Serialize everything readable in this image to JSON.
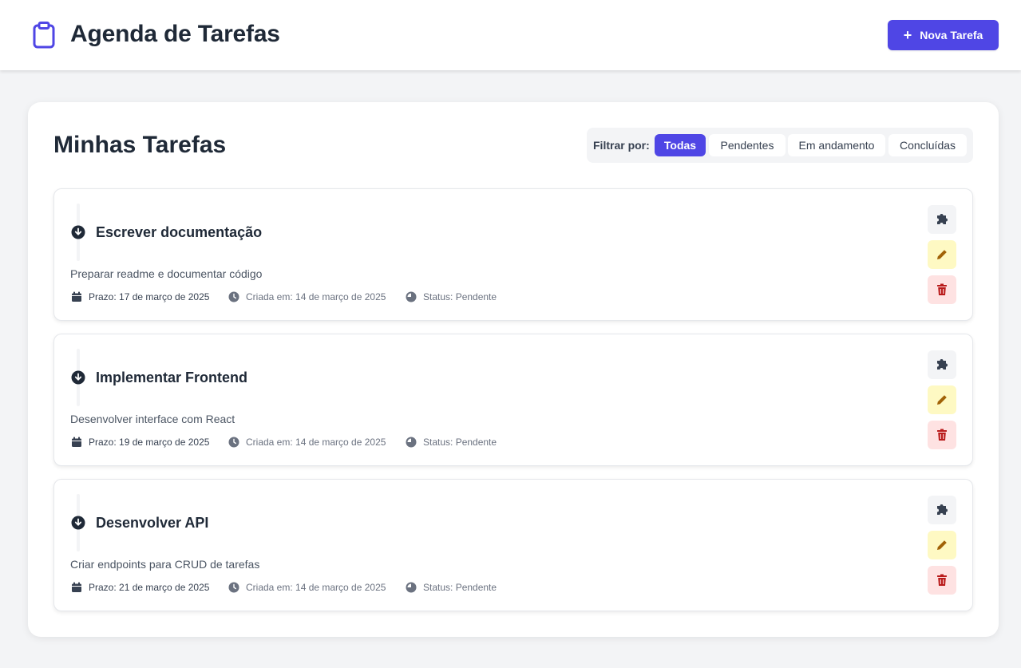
{
  "header": {
    "title": "Agenda de Tarefas",
    "icon": "clipboard-icon",
    "new_task_label": "Nova Tarefa"
  },
  "main": {
    "title": "Minhas Tarefas",
    "filter": {
      "label": "Filtrar por:",
      "options": [
        "Todas",
        "Pendentes",
        "Em andamento",
        "Concluídas"
      ],
      "selected": "Todas"
    },
    "tasks": [
      {
        "title": "Escrever documentação",
        "description": "Preparar readme e documentar código",
        "due": "Prazo: 17 de março de 2025",
        "created": "Criada em: 14 de março de 2025",
        "status": "Status: Pendente"
      },
      {
        "title": "Implementar Frontend",
        "description": "Desenvolver interface com React",
        "due": "Prazo: 19 de março de 2025",
        "created": "Criada em: 14 de março de 2025",
        "status": "Status: Pendente"
      },
      {
        "title": "Desenvolver API",
        "description": "Criar endpoints para CRUD de tarefas",
        "due": "Prazo: 21 de março de 2025",
        "created": "Criada em: 14 de março de 2025",
        "status": "Status: Pendente"
      }
    ]
  },
  "colors": {
    "accent": "#4f46e5",
    "edit_bg": "#fef9c3",
    "edit_icon": "#a16207",
    "delete_bg": "#fee2e2",
    "delete_icon": "#b91c1c"
  }
}
